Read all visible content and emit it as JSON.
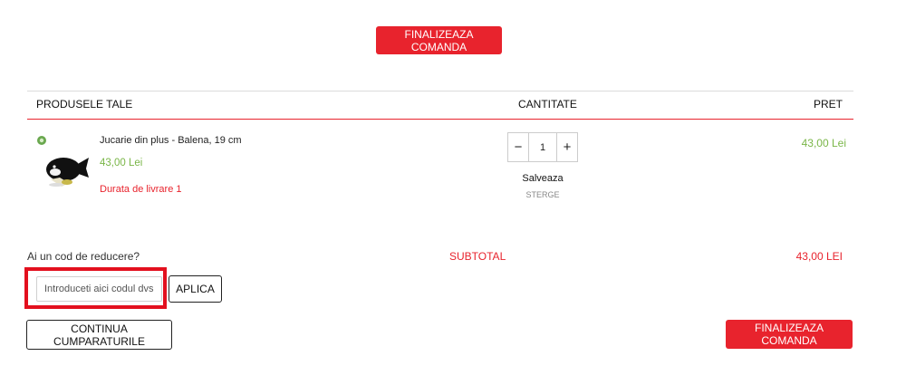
{
  "top_checkout_label": "FINALIZEAZA COMANDA",
  "headers": {
    "products": "PRODUSELE TALE",
    "quantity": "CANTITATE",
    "price": "PRET"
  },
  "item": {
    "name": "Jucarie din plus - Balena, 19 cm",
    "unit_price": "43,00 Lei",
    "delivery": "Durata de livrare 1",
    "quantity": "1",
    "minus": "−",
    "plus": "+",
    "save_label": "Salveaza",
    "delete_label": "STERGE",
    "row_price": "43,00 Lei"
  },
  "coupon": {
    "question": "Ai un cod de reducere?",
    "placeholder": "Introduceti aici codul dvs",
    "apply_label": "APLICA"
  },
  "subtotal": {
    "label": "SUBTOTAL",
    "value": "43,00 LEI"
  },
  "continue_label": "CONTINUA CUMPARATURILE",
  "bottom_checkout_label": "FINALIZEAZA COMANDA",
  "colors": {
    "accent": "#e8232d",
    "price_green": "#7ab648"
  }
}
